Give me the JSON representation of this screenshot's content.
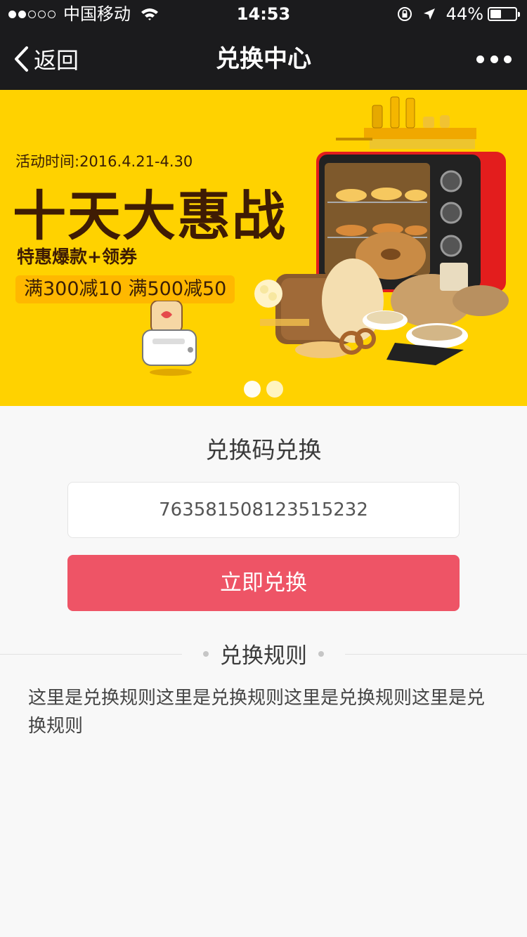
{
  "status_bar": {
    "carrier": "中国移动",
    "time": "14:53",
    "battery_percent": "44%",
    "battery_level": 0.44,
    "signal_bars_filled": 2,
    "signal_bars_total": 5
  },
  "nav": {
    "back_label": "返回",
    "title": "兑换中心"
  },
  "banner": {
    "date": "活动时间:2016.4.21-4.30",
    "headline": "十天大惠战",
    "subtitle": "特惠爆款+领券",
    "promo": "满300减10 满500减50",
    "active_slide": 1,
    "slide_count": 2
  },
  "redeem": {
    "title": "兑换码兑换",
    "code_value": "763581508123515232",
    "button_label": "立即兑换"
  },
  "rules": {
    "heading": "兑换规则",
    "body": "这里是兑换规则这里是兑换规则这里是兑换规则这里是兑换规则"
  },
  "colors": {
    "nav_bg": "#1b1b1d",
    "banner_bg": "#ffd200",
    "button_bg": "#ee5466",
    "page_bg": "#f8f8f8"
  }
}
